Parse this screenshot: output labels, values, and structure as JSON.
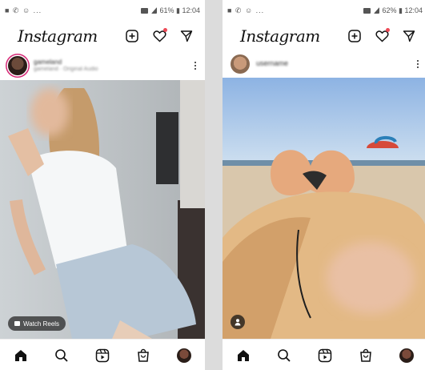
{
  "left": {
    "status": {
      "left_icons": "■ ✆ ☺ ...",
      "battery_time": "61% ▮ 12:04"
    },
    "app": {
      "title": "Instagram"
    },
    "post": {
      "username": "gameland",
      "subtitle": "gameland · Original Audio",
      "badge": "Watch Reels"
    }
  },
  "right": {
    "status": {
      "left_icons": "■ ✆ ☺ ...",
      "battery_time": "62% ▮ 12:04"
    },
    "app": {
      "title": "Instagram"
    },
    "post": {
      "username": "username"
    }
  },
  "icons": {
    "new_post": "plus-square-icon",
    "activity": "heart-icon",
    "direct": "paper-plane-icon",
    "home": "home-icon",
    "search": "search-icon",
    "reels": "reels-icon",
    "shop": "shop-bag-icon",
    "more": "more-vertical-icon"
  },
  "colors": {
    "notification": "#ed4956",
    "story_ring": "#d62976"
  }
}
